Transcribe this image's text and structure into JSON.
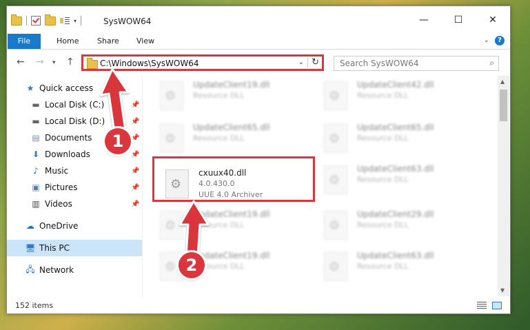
{
  "window": {
    "title": "SysWOW64"
  },
  "ribbon": {
    "tabs": [
      "File",
      "Home",
      "Share",
      "View"
    ],
    "help": "?"
  },
  "address": {
    "path": "C:\\Windows\\SysWOW64"
  },
  "search": {
    "placeholder": "Search SysWOW64"
  },
  "sidebar": {
    "items": [
      {
        "label": "Quick access"
      },
      {
        "label": "Local Disk (C:)"
      },
      {
        "label": "Local Disk (D:)"
      },
      {
        "label": "Documents"
      },
      {
        "label": "Downloads"
      },
      {
        "label": "Music"
      },
      {
        "label": "Pictures"
      },
      {
        "label": "Videos"
      },
      {
        "label": "OneDrive"
      },
      {
        "label": "This PC"
      },
      {
        "label": "Network"
      }
    ]
  },
  "files": [
    {
      "name": "UpdateClient19.dll",
      "type": "Resource DLL"
    },
    {
      "name": "UpdateClient42.dll",
      "type": "Resource DLL"
    },
    {
      "name": "UpdateClient65.dll",
      "type": "Resource DLL"
    },
    {
      "name": "UpdateClient65.dll",
      "type": "Resource DLL"
    },
    {
      "name": "cxuux40.dll",
      "version": "4.0.430.0",
      "type": "UUE 4.0 Archiver"
    },
    {
      "name": "UpdateClient63.dll",
      "type": "Resource DLL"
    },
    {
      "name": "UpdateClient19.dll",
      "type": "Resource DLL"
    },
    {
      "name": "UpdateClient29.dll",
      "type": "Resource DLL"
    },
    {
      "name": "UpdateClient19.dll",
      "type": "Resource DLL"
    },
    {
      "name": "UpdateClient63.dll",
      "type": "Resource DLL"
    }
  ],
  "status": {
    "item_count": "152 items"
  },
  "annotations": {
    "step1": "1",
    "step2": "2"
  },
  "colors": {
    "accent": "#1979ca",
    "highlight": "#d9363e",
    "selected": "#cce4f7"
  }
}
